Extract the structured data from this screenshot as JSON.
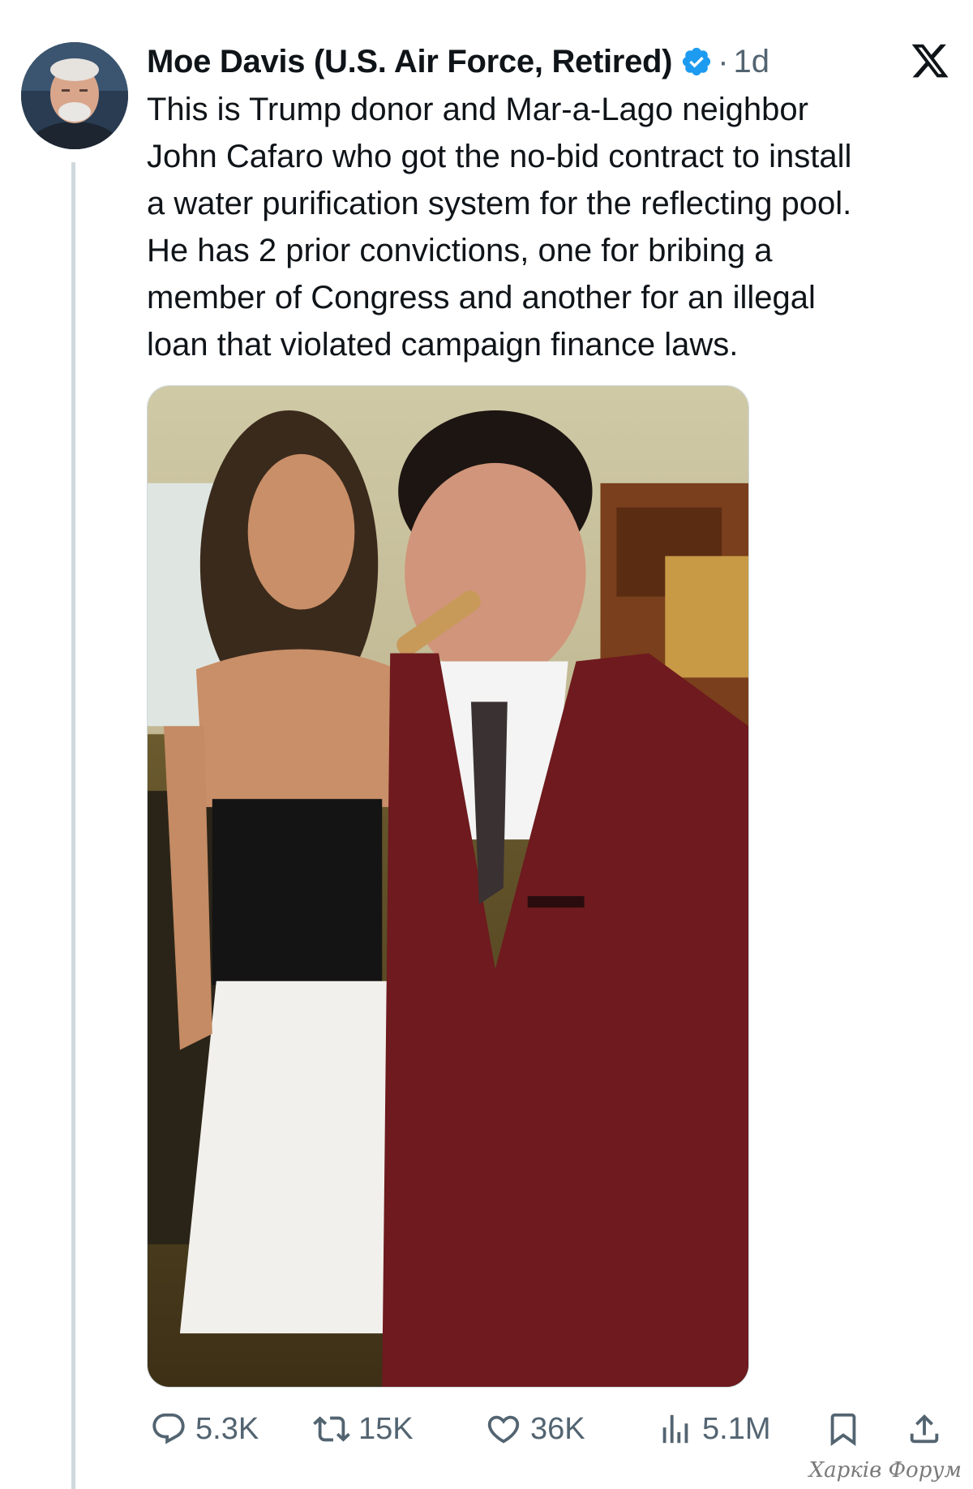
{
  "tweet": {
    "author": "Moe Davis (U.S. Air Force, Retired)",
    "separator": "·",
    "time": "1d",
    "text_lines": [
      "This is Trump donor and Mar-a-Lago neighbor",
      "John Cafaro who got the no-bid contract to install",
      "a water purification system for the reflecting pool.",
      "He has 2 prior convictions, one for bribing a",
      "member of Congress and another for an illegal",
      "loan that violated campaign finance laws."
    ]
  },
  "actions": {
    "replies": "5.3K",
    "reposts": "15K",
    "likes": "36K",
    "views": "5.1M"
  },
  "watermark": "Харків Форум",
  "icons": [
    "verified-badge-icon",
    "x-logo-icon",
    "reply-icon",
    "repost-icon",
    "like-icon",
    "views-icon",
    "bookmark-icon",
    "share-icon"
  ],
  "colors": {
    "verified": "#1d9bf0",
    "muted": "#536471",
    "text": "#0f1419",
    "thread_line": "#cfd9de"
  }
}
